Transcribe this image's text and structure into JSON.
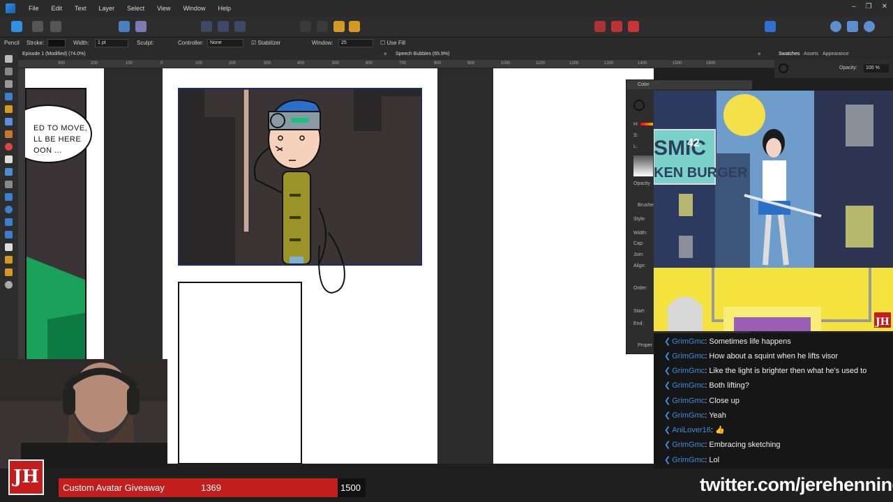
{
  "menu": [
    "File",
    "Edit",
    "Text",
    "Layer",
    "Select",
    "View",
    "Window",
    "Help"
  ],
  "window_controls": [
    "–",
    "❐",
    "✕"
  ],
  "context": {
    "tool": "Pencil",
    "stroke_label": "Stroke:",
    "width_label": "Width:",
    "width_value": "1 pt",
    "sculpt_label": "Sculpt:",
    "controller_label": "Controller:",
    "controller_value": "None",
    "stabilizer_label": "Stabilizer",
    "window_label": "Window:",
    "window_value": "25",
    "usefill_label": "Use Fill"
  },
  "tabs": [
    {
      "label": "Episode 1 (Modified) (74.0%)",
      "close": "×"
    },
    {
      "label": "Speech Bubbles (65.9%)",
      "close": "×"
    }
  ],
  "ruler": [
    "300",
    "200",
    "100",
    "0",
    "100",
    "200",
    "300",
    "400",
    "500",
    "600",
    "700",
    "800",
    "900",
    "1000",
    "1100",
    "1200",
    "1300",
    "1400",
    "1500",
    "1600"
  ],
  "right_tabs": [
    "Swatches",
    "Assets",
    "Appearance"
  ],
  "opacity_label": "Opacity:",
  "opacity_value": "100 %",
  "color_panel": {
    "title": "Color",
    "labels": [
      "H:",
      "S:",
      "L:",
      "Opacity",
      "Brushes",
      "Style:",
      "Width:",
      "Cap:",
      "Join:",
      "Align:",
      "Order:",
      "Start:",
      "End:",
      "Proper"
    ]
  },
  "bubble_lines": [
    "ED TO MOVE,",
    "LL BE HERE",
    "OON ..."
  ],
  "overlay_sign": {
    "line1": "SMIC",
    "num": "42",
    "line2": "KEN BURGER",
    "brand": "JH"
  },
  "chat": [
    {
      "user": "GrimGmc",
      "message": "Sometimes life happens"
    },
    {
      "user": "GrimGmc",
      "message": "How about a squint when he lifts visor"
    },
    {
      "user": "GrimGmc",
      "message": "Like the light is brighter then what he's used to"
    },
    {
      "user": "GrimGmc",
      "message": "Both lifting?"
    },
    {
      "user": "GrimGmc",
      "message": "Close up"
    },
    {
      "user": "GrimGmc",
      "message": "Yeah"
    },
    {
      "user": "AniLover16",
      "message": "👍"
    },
    {
      "user": "GrimGmc",
      "message": "Embracing sketching"
    },
    {
      "user": "GrimGmc",
      "message": "Lol"
    }
  ],
  "giveaway": {
    "label": "Custom Avatar Giveaway",
    "current": "1369",
    "goal": "1500",
    "progress": 0.9127
  },
  "brand_logo": "JH",
  "twitter": "twitter.com/jerehenning",
  "colors": {
    "accent": "#c41d1d",
    "chat_user": "#3b8ee0",
    "frame_border": "#1d2d6a"
  }
}
